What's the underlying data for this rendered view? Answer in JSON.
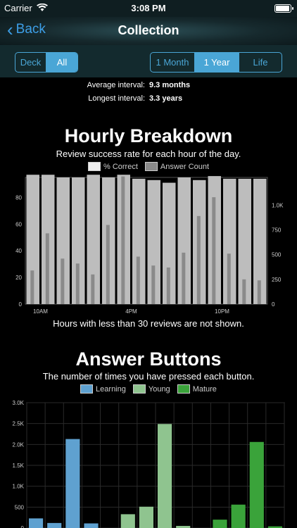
{
  "status": {
    "carrier": "Carrier",
    "time": "3:08 PM"
  },
  "nav": {
    "back_label": "Back",
    "title": "Collection"
  },
  "deck_toggle": {
    "options": [
      "Deck",
      "All"
    ],
    "selected": "All"
  },
  "range_toggle": {
    "options": [
      "1 Month",
      "1 Year",
      "Life"
    ],
    "selected": "1 Year"
  },
  "stats": [
    {
      "label": "Average interval:",
      "value": "9.3 months"
    },
    {
      "label": "Longest interval:",
      "value": "3.3 years"
    }
  ],
  "hourly": {
    "title": "Hourly Breakdown",
    "subtitle": "Review success rate for each hour of the day.",
    "legend": [
      "% Correct",
      "Answer Count"
    ],
    "footnote": "Hours with less than 30 reviews are not shown.",
    "colors": {
      "correct": "#bdbdbd",
      "count": "#8a8a8a"
    }
  },
  "answers": {
    "title": "Answer Buttons",
    "subtitle": "The number of times you have pressed each button.",
    "legend": [
      "Learning",
      "Young",
      "Mature"
    ],
    "colors": {
      "learning": "#5fa1d0",
      "young": "#8fc48f",
      "mature": "#3aa33a"
    }
  },
  "chart_data": [
    {
      "type": "bar",
      "categories": [
        "9",
        "10",
        "11",
        "12",
        "13",
        "14",
        "15",
        "16",
        "17",
        "18",
        "19",
        "20",
        "21",
        "22",
        "23",
        "24"
      ],
      "x_tick_labels": [
        "10AM",
        "4PM",
        "10PM"
      ],
      "series": [
        {
          "name": "% Correct",
          "axis": "left",
          "values": [
            97,
            97,
            95,
            95,
            97,
            95,
            97,
            94,
            93,
            91,
            95,
            93,
            96,
            94,
            94,
            94
          ]
        },
        {
          "name": "Answer Count",
          "axis": "right",
          "values": [
            340,
            715,
            460,
            410,
            300,
            800,
            1290,
            480,
            390,
            370,
            520,
            890,
            1080,
            510,
            250,
            240
          ]
        }
      ],
      "y_left_ticks": [
        "0",
        "20",
        "40",
        "60",
        "80"
      ],
      "y_right_ticks": [
        "0",
        "250",
        "500",
        "750",
        "1.0K"
      ],
      "ylim_left": [
        0,
        95
      ],
      "ylim_right": [
        0,
        1280
      ]
    },
    {
      "type": "bar",
      "categories": [
        "L1",
        "L2",
        "L3",
        "L4",
        "gap1",
        "Y1",
        "Y2",
        "Y3",
        "Y4",
        "gap2",
        "M1",
        "M2",
        "M3",
        "M4"
      ],
      "series": [
        {
          "name": "Learning",
          "values": [
            230,
            120,
            2130,
            110,
            null,
            null,
            null,
            null,
            null,
            null,
            null,
            null,
            null,
            null
          ]
        },
        {
          "name": "Young",
          "values": [
            null,
            null,
            null,
            null,
            null,
            330,
            510,
            2490,
            50,
            null,
            null,
            null,
            null,
            null
          ]
        },
        {
          "name": "Mature",
          "values": [
            null,
            null,
            null,
            null,
            null,
            null,
            null,
            null,
            null,
            null,
            200,
            560,
            2060,
            40
          ]
        }
      ],
      "y_ticks": [
        "0",
        "500",
        "1.0K",
        "1.5K",
        "2.0K",
        "2.5K",
        "3.0K"
      ],
      "ylim": [
        0,
        3000
      ]
    }
  ]
}
